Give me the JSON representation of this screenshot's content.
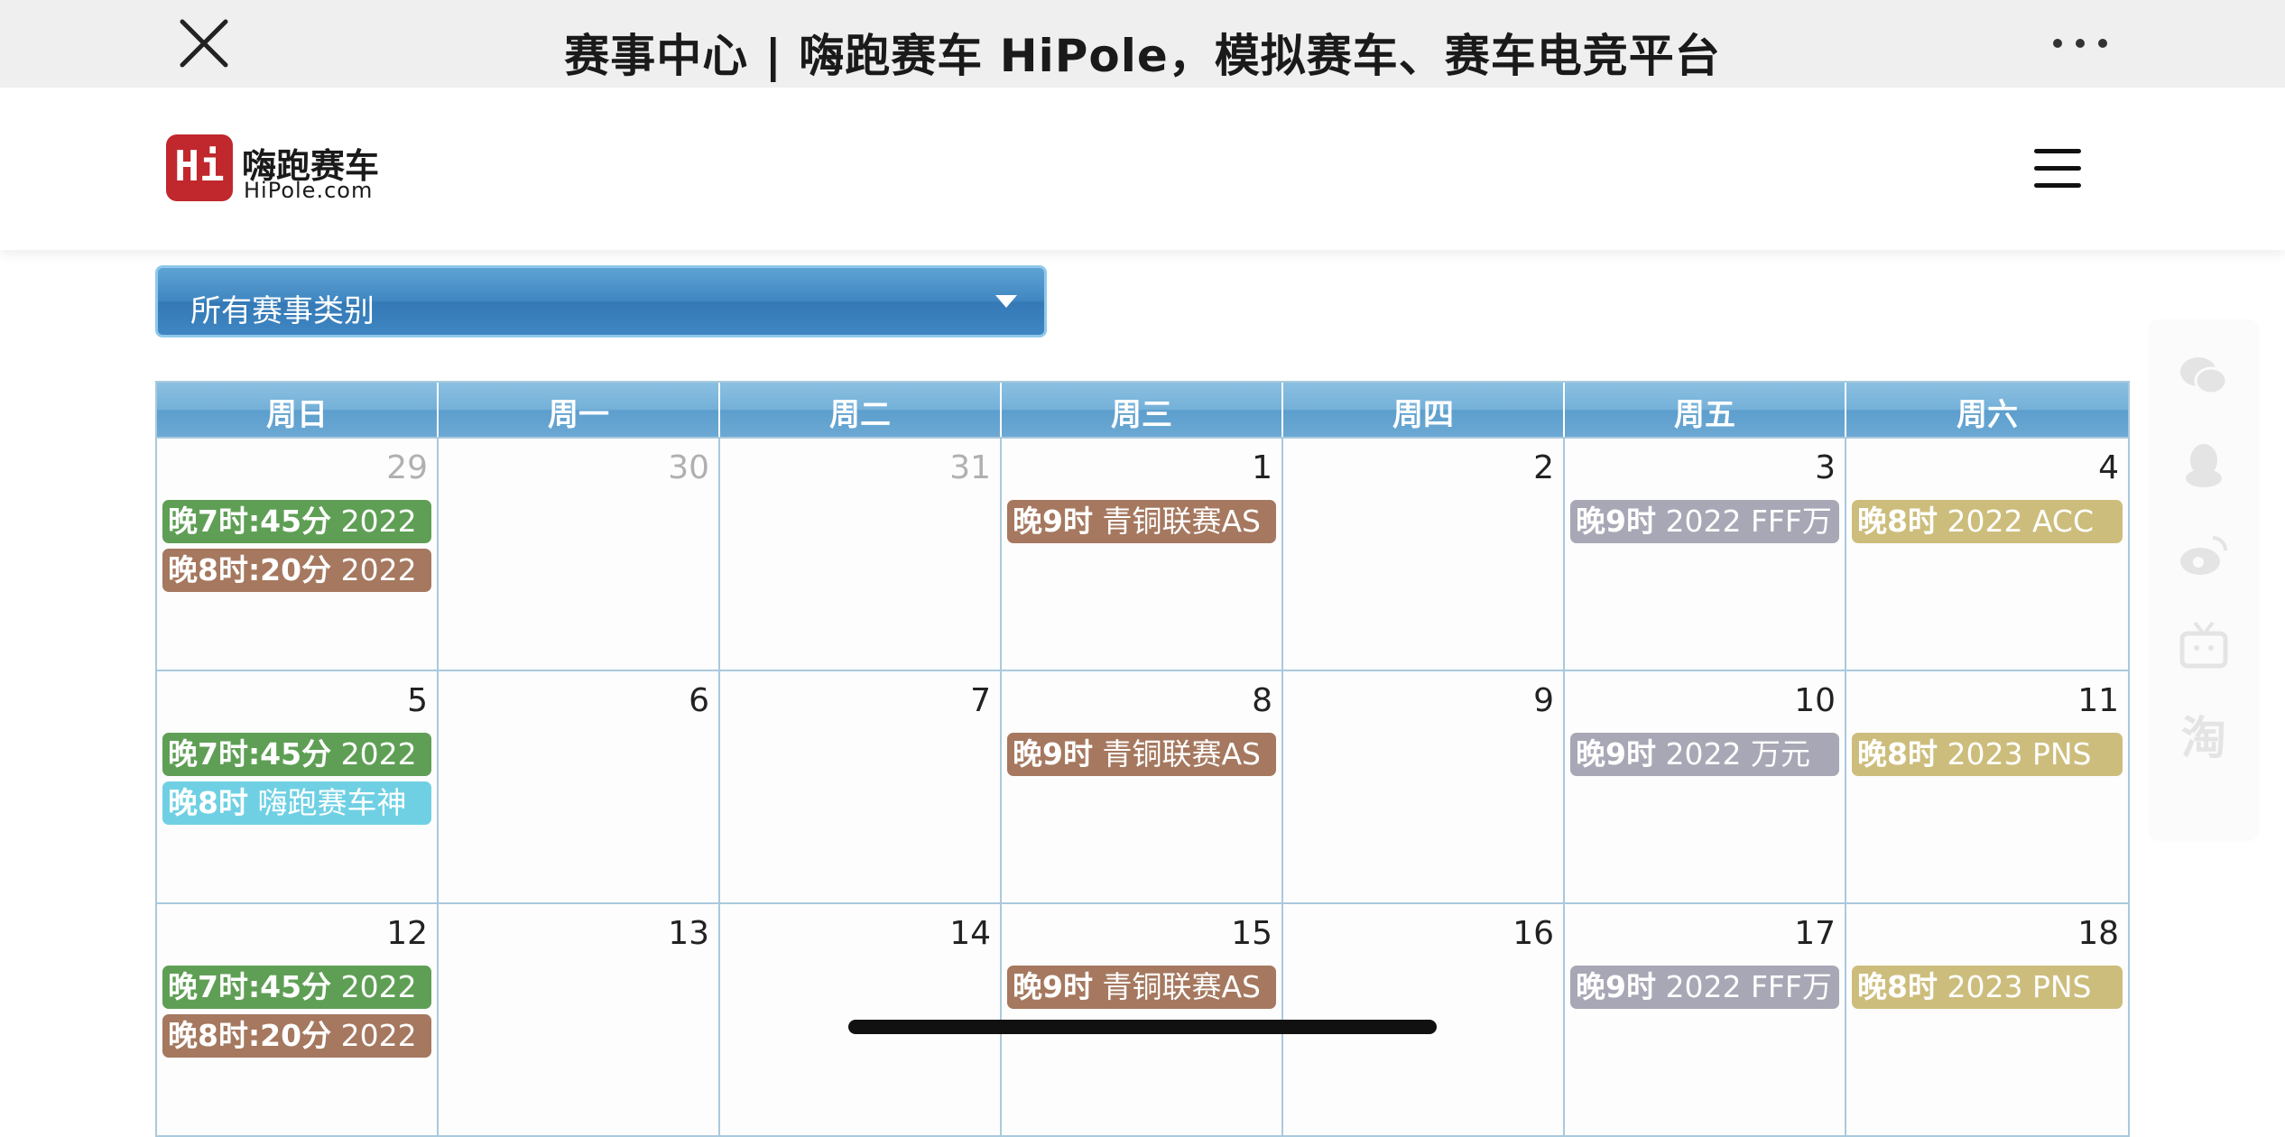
{
  "browser": {
    "title": "赛事中心 | 嗨跑赛车 HiPole，模拟赛车、赛车电竞平台"
  },
  "site": {
    "logo_mark": "Hi",
    "logo_cn": "嗨跑赛车",
    "logo_en": "HiPole.com"
  },
  "filter": {
    "selected": "所有赛事类别"
  },
  "calendar": {
    "weekdays": [
      "周日",
      "周一",
      "周二",
      "周三",
      "周四",
      "周五",
      "周六"
    ],
    "weeks": [
      [
        {
          "day": "29",
          "other": true,
          "events": [
            {
              "time": "晚7时:45分",
              "name": "2022",
              "color": "green"
            },
            {
              "time": "晚8时:20分",
              "name": "2022",
              "color": "brown"
            }
          ]
        },
        {
          "day": "30",
          "other": true,
          "events": []
        },
        {
          "day": "31",
          "other": true,
          "events": []
        },
        {
          "day": "1",
          "events": [
            {
              "time": "晚9时",
              "name": "青铜联赛AS",
              "color": "brown"
            }
          ]
        },
        {
          "day": "2",
          "events": []
        },
        {
          "day": "3",
          "events": [
            {
              "time": "晚9时",
              "name": "2022 FFF万",
              "color": "grey"
            }
          ]
        },
        {
          "day": "4",
          "events": [
            {
              "time": "晚8时",
              "name": "2022 ACC",
              "color": "gold"
            }
          ]
        }
      ],
      [
        {
          "day": "5",
          "events": [
            {
              "time": "晚7时:45分",
              "name": "2022",
              "color": "green"
            },
            {
              "time": "晚8时",
              "name": "嗨跑赛车神",
              "color": "cyan"
            }
          ]
        },
        {
          "day": "6",
          "events": []
        },
        {
          "day": "7",
          "events": []
        },
        {
          "day": "8",
          "events": [
            {
              "time": "晚9时",
              "name": "青铜联赛AS",
              "color": "brown"
            }
          ]
        },
        {
          "day": "9",
          "events": []
        },
        {
          "day": "10",
          "events": [
            {
              "time": "晚9时",
              "name": "2022 万元",
              "color": "grey"
            }
          ]
        },
        {
          "day": "11",
          "events": [
            {
              "time": "晚8时",
              "name": "2023 PNS",
              "color": "gold"
            }
          ]
        }
      ],
      [
        {
          "day": "12",
          "events": [
            {
              "time": "晚7时:45分",
              "name": "2022",
              "color": "green"
            },
            {
              "time": "晚8时:20分",
              "name": "2022",
              "color": "brown"
            }
          ]
        },
        {
          "day": "13",
          "events": []
        },
        {
          "day": "14",
          "events": []
        },
        {
          "day": "15",
          "events": [
            {
              "time": "晚9时",
              "name": "青铜联赛AS",
              "color": "brown"
            }
          ]
        },
        {
          "day": "16",
          "events": []
        },
        {
          "day": "17",
          "events": [
            {
              "time": "晚9时",
              "name": "2022 FFF万",
              "color": "grey"
            }
          ]
        },
        {
          "day": "18",
          "events": [
            {
              "time": "晚8时",
              "name": "2023 PNS",
              "color": "gold"
            }
          ]
        }
      ]
    ]
  },
  "share": {
    "icons": [
      "wechat-icon",
      "qq-icon",
      "weibo-icon",
      "tv-icon",
      "taobao-icon"
    ],
    "taobao_glyph": "淘"
  }
}
